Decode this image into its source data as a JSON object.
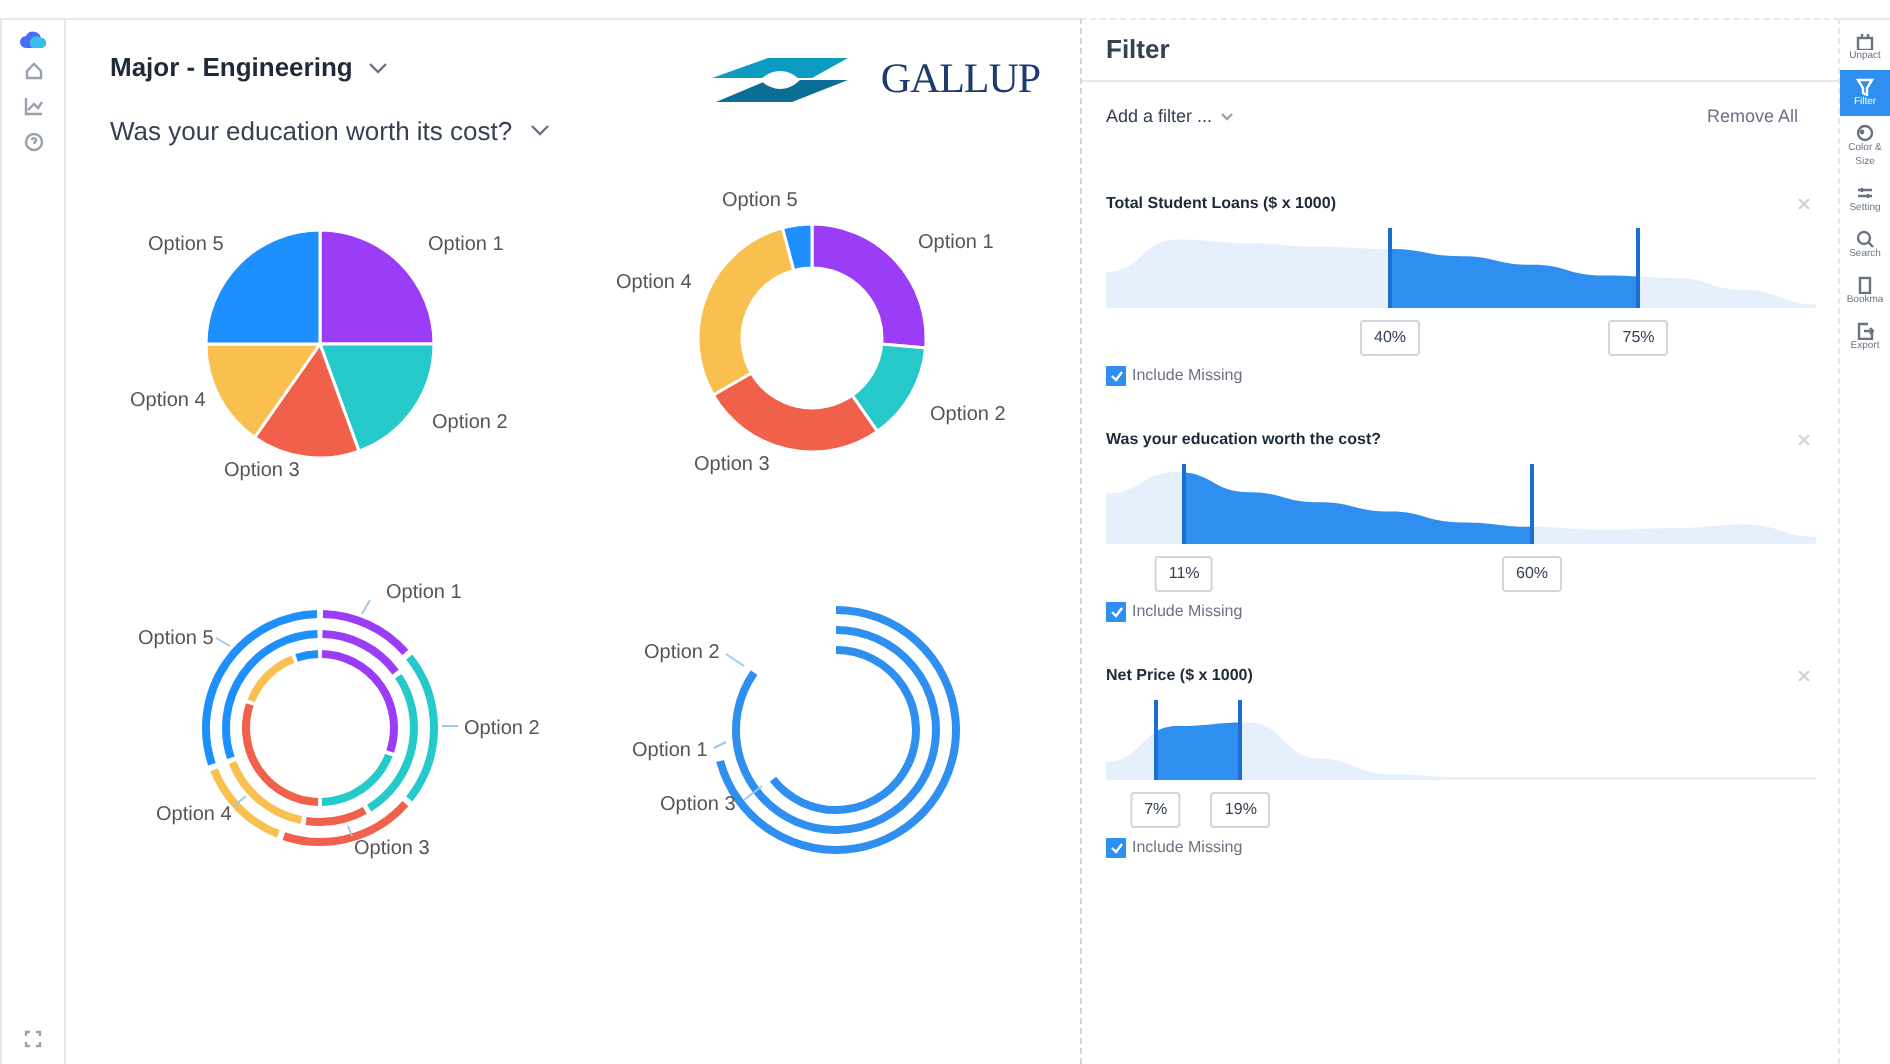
{
  "nav": {
    "items": [
      {
        "kind": "home"
      },
      {
        "kind": "chart"
      },
      {
        "kind": "help"
      }
    ]
  },
  "header": {
    "dimension": "Major - Engineering",
    "question": "Was your education worth its cost?",
    "logo_text": "GALLUP"
  },
  "charts": [
    {
      "kind": "pie",
      "labels": [
        {
          "text": "Option 1",
          "color": "#9b3cf7"
        },
        {
          "text": "Option 2",
          "color": "#26c9c9"
        },
        {
          "text": "Option 3",
          "color": "#f0604a"
        },
        {
          "text": "Option 4",
          "color": "#f9bf4f"
        },
        {
          "text": "Option 5",
          "color": "#1e8fff"
        }
      ]
    },
    {
      "kind": "donut",
      "labels": [
        {
          "text": "Option 1",
          "color": "#9b3cf7"
        },
        {
          "text": "Option 2",
          "color": "#26c9c9"
        },
        {
          "text": "Option 3",
          "color": "#f0604a"
        },
        {
          "text": "Option 4",
          "color": "#f9bf4f"
        },
        {
          "text": "Option 5",
          "color": "#1e8fff"
        }
      ]
    },
    {
      "kind": "rings",
      "labels": [
        {
          "text": "Option 1",
          "color": "#9b3cf7"
        },
        {
          "text": "Option 2",
          "color": "#26c9c9"
        },
        {
          "text": "Option 3",
          "color": "#f0604a"
        },
        {
          "text": "Option 4",
          "color": "#f9bf4f"
        },
        {
          "text": "Option 5",
          "color": "#1e8fff"
        }
      ]
    },
    {
      "kind": "radial_bar",
      "labels": [
        {
          "text": "Option 2",
          "color": "#2f8ff0"
        },
        {
          "text": "Option 1",
          "color": "#2f8ff0"
        },
        {
          "text": "Option 3",
          "color": "#2f8ff0"
        }
      ]
    }
  ],
  "filter_panel": {
    "title": "Filter",
    "add_filter": "Add a filter ...",
    "remove_all": "Remove All",
    "filters": [
      {
        "title": "Total Student Loans ($ x 1000)",
        "start": {
          "label": "40%"
        },
        "end": {
          "label": "75%"
        },
        "include_missing": {
          "label": "Include Missing",
          "checked": true
        }
      },
      {
        "title": "Was your education worth the cost?",
        "start": {
          "label": "11%"
        },
        "end": {
          "label": "60%"
        },
        "include_missing": {
          "label": "Include Missing",
          "checked": true
        }
      },
      {
        "title": "Net Price ($ x 1000)",
        "start": {
          "label": "7%"
        },
        "end": {
          "label": "19%"
        },
        "include_missing": {
          "label": "Include Missing",
          "checked": true
        }
      }
    ]
  },
  "toolbar": [
    {
      "kind": "unpack",
      "label": "Unpact",
      "selected": false
    },
    {
      "kind": "filter",
      "label": "Filter",
      "selected": true
    },
    {
      "kind": "color",
      "label": "Color &",
      "label2": "Size",
      "selected": false
    },
    {
      "kind": "settings",
      "label": "Setting",
      "selected": false
    },
    {
      "kind": "search",
      "label": "Search",
      "selected": false
    },
    {
      "kind": "bookmark",
      "label": "Bookma",
      "selected": false
    },
    {
      "kind": "export",
      "label": "Export",
      "selected": false
    }
  ]
}
